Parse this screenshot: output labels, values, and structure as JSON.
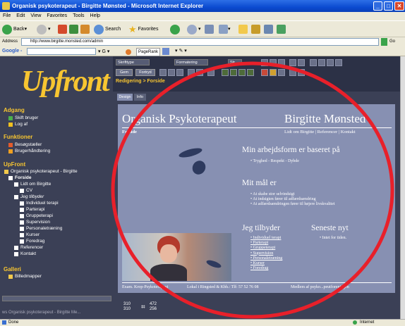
{
  "window": {
    "title": "Organisk psykoterapeut - Birgitte Mønsted - Microsoft Internet Explorer"
  },
  "menu": [
    "File",
    "Edit",
    "View",
    "Favorites",
    "Tools",
    "Help"
  ],
  "toolbar": {
    "back": "Back",
    "search": "Search",
    "favorites": "Favorites"
  },
  "address": {
    "label": "Address",
    "url": "http://www.birgitte.monsted.com/admin",
    "go": "Go"
  },
  "google": {
    "label": "Google -",
    "pagerank": "PageRank"
  },
  "sidebar": {
    "logo": "Upfront",
    "sections": [
      {
        "heading": "Adgang",
        "items": [
          "Skift bruger",
          "Log af"
        ]
      },
      {
        "heading": "Funktioner",
        "items": [
          "Besøgstæller",
          "Brugerhåndtering"
        ]
      },
      {
        "heading": "UpFront",
        "items": [
          "Organisk psykoterapeut - Birgitte",
          "Forside",
          "Lidt om Birgitte",
          "CV",
          "Jeg tilbyder",
          "Individuel terapi",
          "Parterapi",
          "Gruppeterapi",
          "Supervision",
          "Personaletræning",
          "Kurser",
          "Foredrag",
          "Referencer",
          "Kontakt"
        ]
      },
      {
        "heading": "Galleri",
        "items": [
          "Billedmapper"
        ]
      }
    ],
    "footer": "ws Organisk psykoterapeut - Birgitte Me..."
  },
  "editor": {
    "style_select": "Skrifttype",
    "format_select": "Formatering",
    "size_select": "Str",
    "save": "Gem",
    "cancel": "Fortryd",
    "breadcrumb": "Redigering > Forside",
    "tabs": [
      "Design",
      "Info"
    ]
  },
  "content": {
    "site_title": "Organisk Psykoterapeut",
    "site_name": "Birgitte Mønsted",
    "page": "Forside",
    "nav": "Lidt om Birgitte | Referencer | Kontakt",
    "h1": "Min arbejdsform er baseret på",
    "list1": [
      "Tryghed - Respekt - Dybde"
    ],
    "h2": "Mit mål er",
    "list2": [
      "At skabe stor selvindsigt",
      "At indsigten fører til adfærdsændring",
      "At adfærdsændringen fører til højere livskvalitet"
    ],
    "h3": "Jeg tilbyder",
    "list3": [
      "Individuel terapi",
      "Parterapi",
      "Gruppeterapi",
      "Supervision",
      "Personaletræning",
      "Kurser",
      "Foredrag"
    ],
    "h4": "Seneste nyt",
    "list4": [
      "Intet for tiden."
    ],
    "footer_left": "Exam. Krop-Psykoterapeut",
    "footer_mid": "Lokal i Ringsted & Kbh.: Tlf: 57 52 76 08",
    "footer_right": "Medlem af psyko...peutforeningen"
  },
  "coords": {
    "x1": "310",
    "y1": "310",
    "x2": "472",
    "y2": "256"
  },
  "status": {
    "left": "Done",
    "right": "Internet"
  }
}
